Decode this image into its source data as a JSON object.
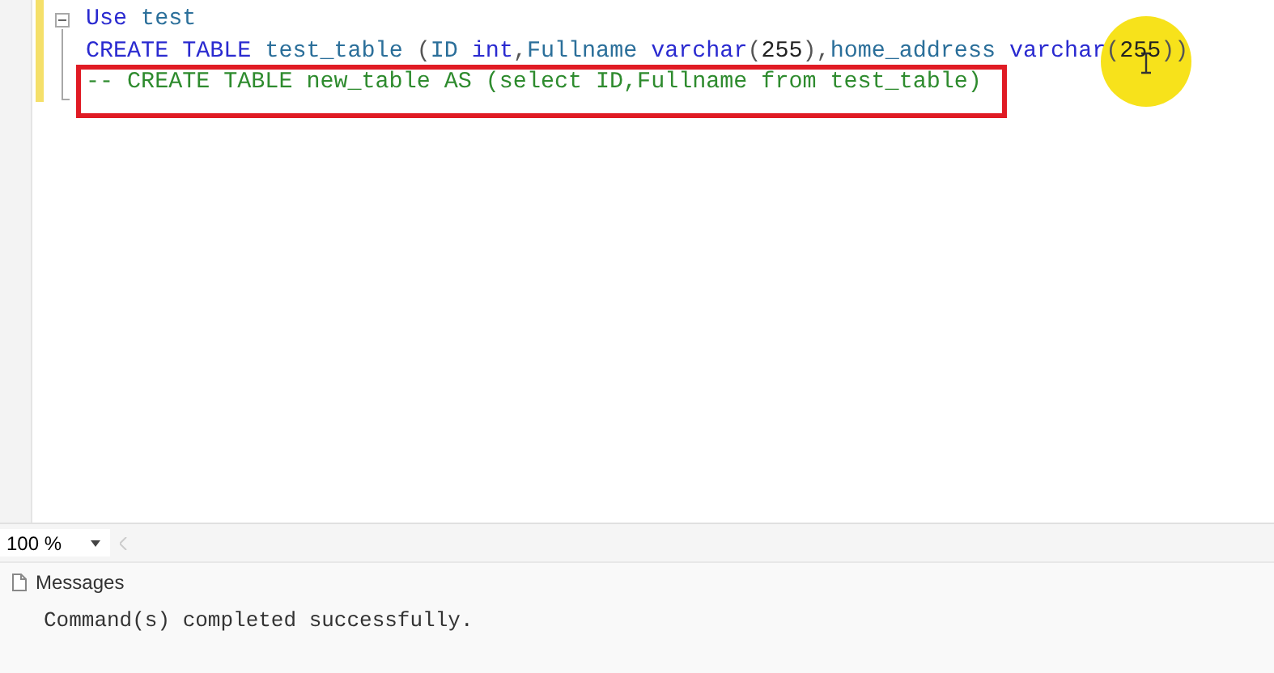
{
  "editor": {
    "lines": [
      {
        "tokens": [
          {
            "text": "Use",
            "kind": "keyword"
          },
          {
            "text": " test",
            "kind": "ident"
          }
        ],
        "fold": true,
        "highlighted": false
      },
      {
        "tokens": [
          {
            "text": "CREATE ",
            "kind": "keyword"
          },
          {
            "text": "TABLE",
            "kind": "keyword"
          },
          {
            "text": " test_table ",
            "kind": "ident"
          },
          {
            "text": "(",
            "kind": "punct"
          },
          {
            "text": "ID ",
            "kind": "ident"
          },
          {
            "text": "int",
            "kind": "keyword"
          },
          {
            "text": ",",
            "kind": "punct"
          },
          {
            "text": "Fullname ",
            "kind": "ident"
          },
          {
            "text": "varchar",
            "kind": "keyword"
          },
          {
            "text": "(",
            "kind": "punct"
          },
          {
            "text": "255",
            "kind": "number"
          },
          {
            "text": ")",
            "kind": "punct"
          },
          {
            "text": ",",
            "kind": "punct"
          },
          {
            "text": "home_address ",
            "kind": "ident"
          },
          {
            "text": "varchar",
            "kind": "keyword"
          },
          {
            "text": "(",
            "kind": "punct"
          },
          {
            "text": "255",
            "kind": "number"
          },
          {
            "text": "))",
            "kind": "punct"
          }
        ],
        "fold": false,
        "highlighted": false
      },
      {
        "tokens": [
          {
            "text": "-- CREATE TABLE new_table AS (select ID,Fullname from test_table)",
            "kind": "comment"
          }
        ],
        "fold": false,
        "highlighted": true
      }
    ]
  },
  "zoom": {
    "value": "100 %"
  },
  "results": {
    "tab": "Messages",
    "message": "Command(s) completed successfully."
  }
}
